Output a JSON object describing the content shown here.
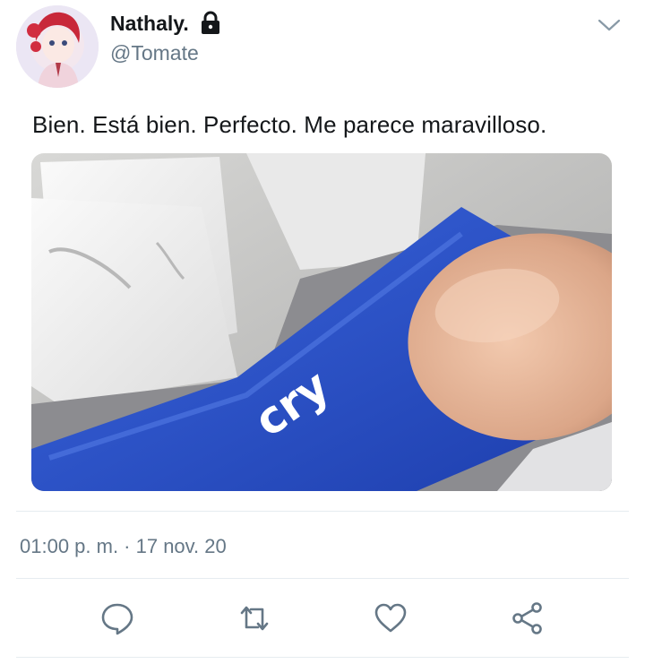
{
  "user": {
    "display_name": "Nathaly.",
    "handle": "@Tomate",
    "protected_icon": "lock-icon"
  },
  "tweet": {
    "text": "Bien. Está bien. Perfecto. Me parece maravilloso.",
    "media_key_label": "cry",
    "timestamp": "01:00 p. m. · 17 nov. 20"
  },
  "actions": {
    "menu_icon": "chevron-down-icon",
    "reply_icon": "reply-icon",
    "retweet_icon": "retweet-icon",
    "like_icon": "heart-icon",
    "share_icon": "share-icon"
  },
  "colors": {
    "text_primary": "#14171a",
    "text_secondary": "#657786",
    "divider": "#e6ecf0",
    "key_blue": "#2a55cf"
  }
}
